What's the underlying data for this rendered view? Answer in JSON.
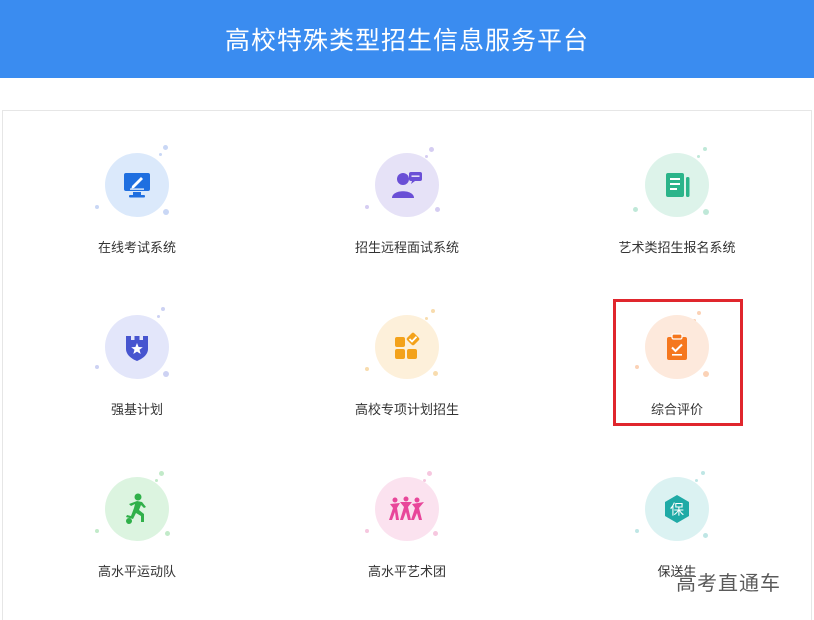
{
  "header": {
    "title": "高校特殊类型招生信息服务平台"
  },
  "colors": {
    "header_bg": "#3a8cf0",
    "highlight_border": "#e0262d"
  },
  "tiles": [
    {
      "label": "在线考试系统",
      "icon": "monitor-edit-icon",
      "circle": "#dbe9fb",
      "accent": "#1f6fe0"
    },
    {
      "label": "招生远程面试系统",
      "icon": "interview-person-icon",
      "circle": "#e6e2f7",
      "accent": "#6a4fd6"
    },
    {
      "label": "艺术类招生报名系统",
      "icon": "form-document-icon",
      "circle": "#ddf3ea",
      "accent": "#2bb48a"
    },
    {
      "label": "强基计划",
      "icon": "castle-shield-star-icon",
      "circle": "#e3e6fa",
      "accent": "#4755cf"
    },
    {
      "label": "高校专项计划招生",
      "icon": "grid-check-icon",
      "circle": "#fdf0da",
      "accent": "#f3a21b"
    },
    {
      "label": "综合评价",
      "icon": "clipboard-check-icon",
      "circle": "#fde9dc",
      "accent": "#f5771e"
    },
    {
      "label": "高水平运动队",
      "icon": "soccer-player-icon",
      "circle": "#dcf4e0",
      "accent": "#30b04a"
    },
    {
      "label": "高水平艺术团",
      "icon": "dancers-icon",
      "circle": "#fbe2ef",
      "accent": "#e8469a"
    },
    {
      "label": "保送生",
      "icon": "bao-badge-icon",
      "circle": "#dbf2f2",
      "accent": "#1faaa6",
      "glyph": "保"
    }
  ],
  "watermark": "高考直通车"
}
